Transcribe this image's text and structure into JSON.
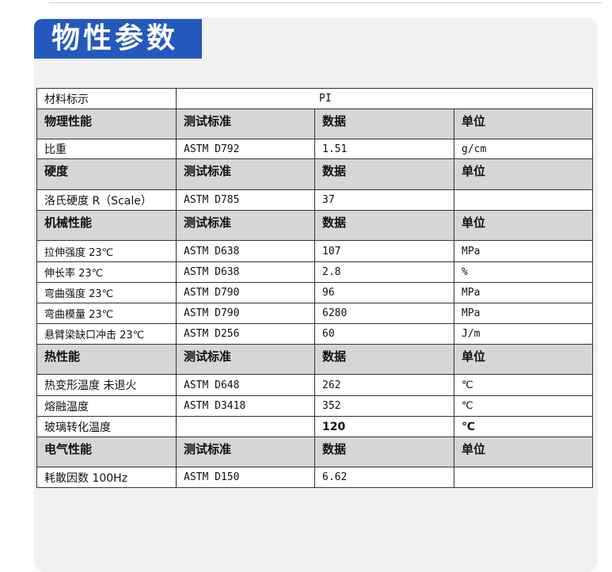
{
  "section_title": "物性参数",
  "material": {
    "label": "材料标示",
    "value": "PI"
  },
  "groups": [
    {
      "header": [
        "物理性能",
        "测试标准",
        "数据",
        "单位"
      ],
      "rows": [
        [
          "比重",
          "ASTM D792",
          "1.51",
          "g/cm"
        ]
      ]
    },
    {
      "header": [
        "硬度",
        "测试标准",
        "数据",
        "单位"
      ],
      "rows": [
        [
          "洛氏硬度 R（Scale）",
          "ASTM D785",
          "37",
          ""
        ]
      ]
    },
    {
      "header": [
        "机械性能",
        "测试标准",
        "数据",
        "单位"
      ],
      "rows": [
        [
          "拉伸强度 23℃",
          "ASTM D638",
          "107",
          "MPa"
        ],
        [
          "伸长率 23℃",
          "ASTM D638",
          "2.8",
          "%"
        ],
        [
          "弯曲强度 23℃",
          "ASTM D790",
          "96",
          "MPa"
        ],
        [
          "弯曲模量 23℃",
          "ASTM D790",
          "6280",
          "MPa"
        ],
        [
          "悬臂梁缺口冲击 23℃",
          "ASTM D256",
          "60",
          "J/m"
        ]
      ]
    },
    {
      "header": [
        "热性能",
        "测试标准",
        "数据",
        "单位"
      ],
      "rows": [
        [
          "热变形温度 未退火",
          "ASTM D648",
          "262",
          "℃"
        ],
        [
          "熔融温度",
          "ASTM D3418",
          "352",
          "℃"
        ],
        [
          "玻璃转化温度",
          "",
          "120",
          "℃"
        ]
      ]
    },
    {
      "header": [
        "电气性能",
        "测试标准",
        "数据",
        "单位"
      ],
      "rows": [
        [
          "耗散因数 100Hz",
          "ASTM D150",
          "6.62",
          ""
        ]
      ]
    }
  ]
}
